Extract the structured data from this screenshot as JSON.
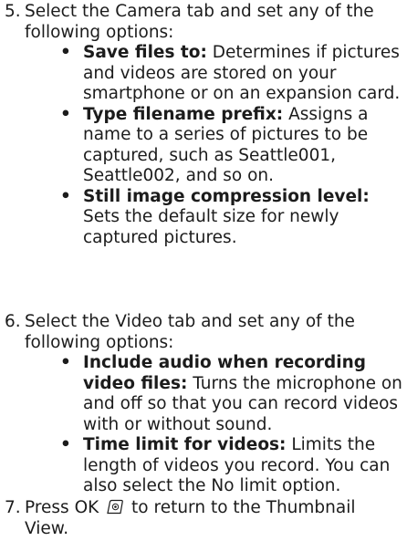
{
  "steps": [
    {
      "number": "5.",
      "intro": "Select the Camera tab and set any of the following options:",
      "options": [
        {
          "term": "Save files to:",
          "description": "Determines if pictures and videos are stored on your smartphone or on an expansion card."
        },
        {
          "term": "Type filename prefix:",
          "description": "Assigns a name to a series of pictures to be captured, such as Seattle001, Seattle002, and so on."
        },
        {
          "term": "Still image compression level:",
          "description": "Sets the default size for newly captured pictures."
        }
      ]
    },
    {
      "number": "6.",
      "intro": "Select the Video tab and set any of the following options:",
      "options": [
        {
          "term": "Include audio when recording video files:",
          "description": "Turns the microphone on and off so that you can record videos with or without sound."
        },
        {
          "term": "Time limit for videos:",
          "description": "Limits the length of videos you record. You can also select the No limit option."
        }
      ]
    },
    {
      "number": "7.",
      "text_before_icon": "Press OK",
      "icon": "ok-key-icon",
      "text_after_icon": "to return to the Thumbnail View."
    }
  ],
  "bullet_glyph": "•"
}
